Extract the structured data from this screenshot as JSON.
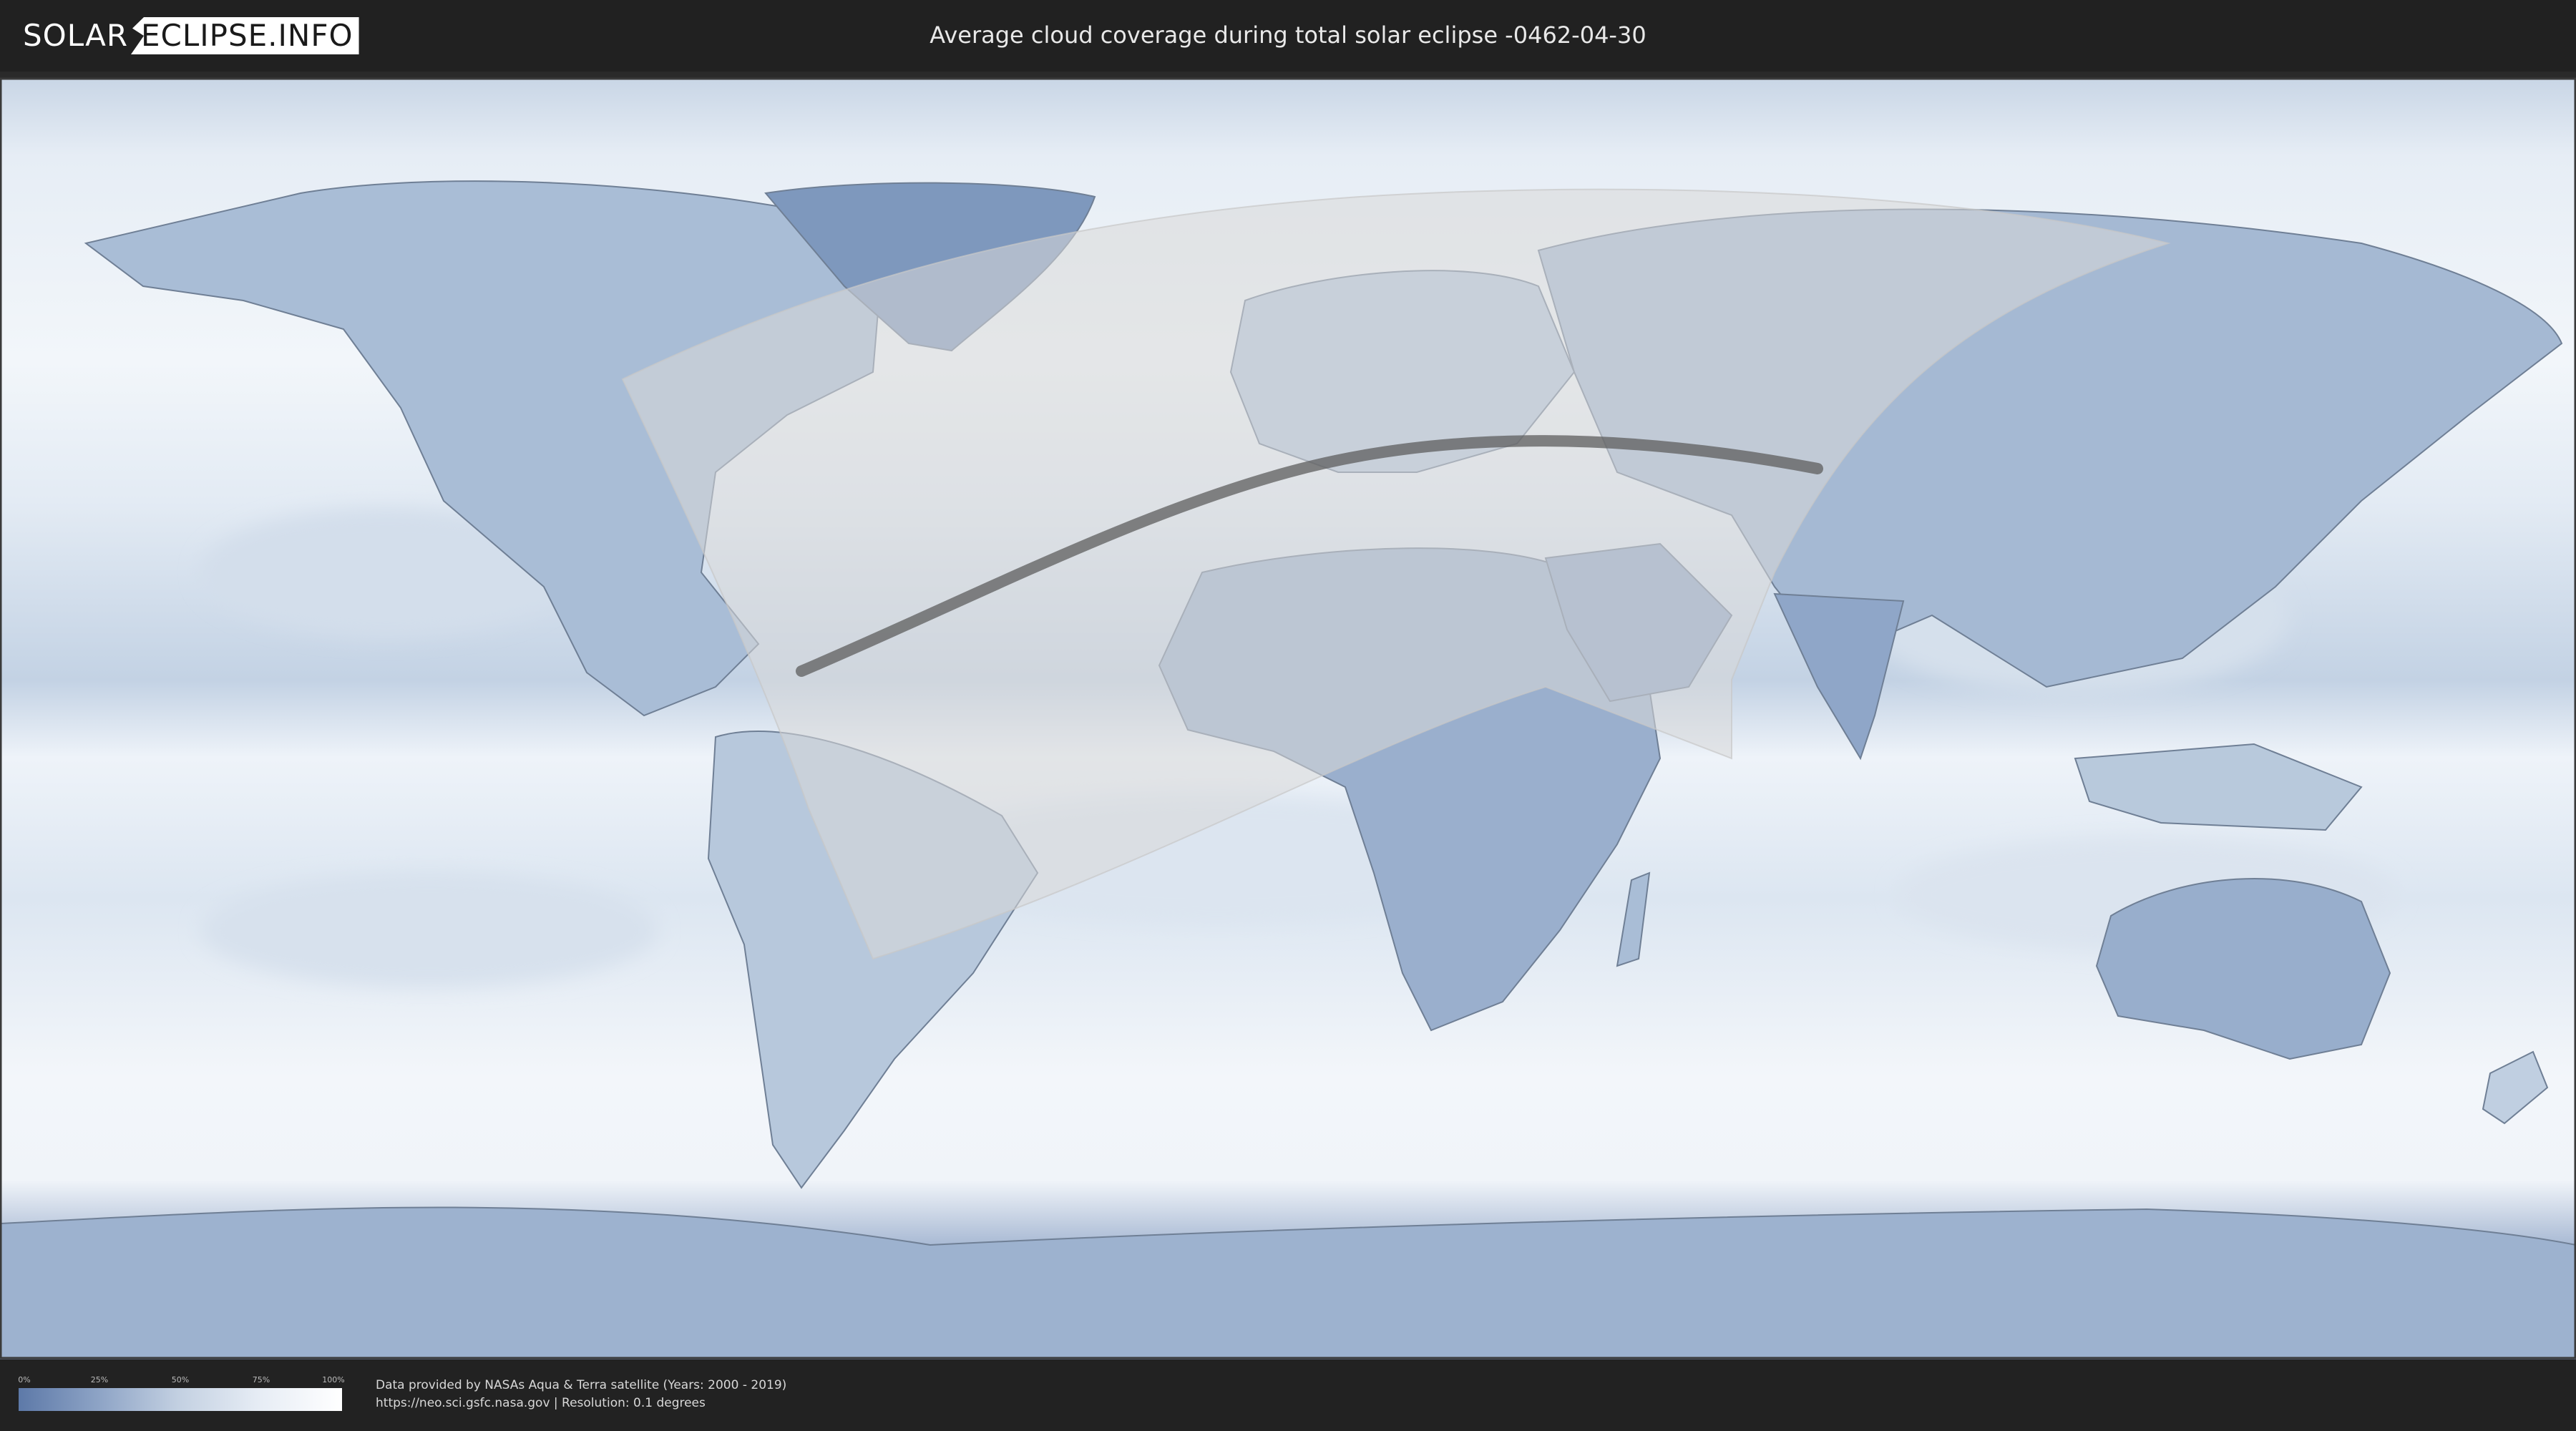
{
  "header": {
    "logo_part1": "SOLAR",
    "logo_part2": "ECLIPSE.INFO",
    "title": "Average cloud coverage during total solar eclipse -0462-04-30"
  },
  "map": {
    "colors": {
      "cloud_clear": "#5d79a8",
      "cloud_full": "#ffffff",
      "visibility_overlay": "#d8d8d8",
      "eclipse_path": "#5e5e5e",
      "coastline": "#6f7f95"
    }
  },
  "legend": {
    "ticks": [
      "0%",
      "25%",
      "50%",
      "75%",
      "100%"
    ]
  },
  "footer": {
    "credit_line1": "Data provided by NASAs Aqua & Terra satellite (Years: 2000 - 2019)",
    "credit_line2": "https://neo.sci.gsfc.nasa.gov | Resolution: 0.1 degrees"
  }
}
